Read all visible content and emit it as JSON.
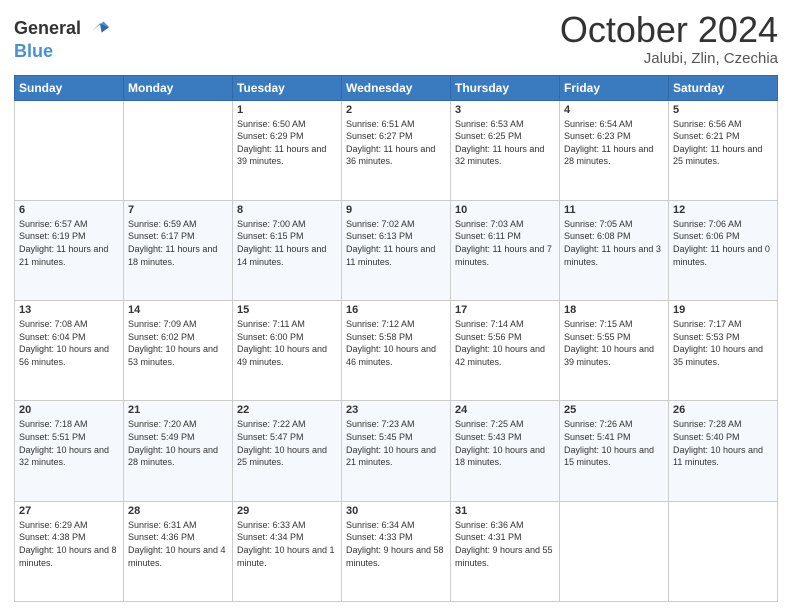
{
  "logo": {
    "line1": "General",
    "line2": "Blue"
  },
  "header": {
    "month": "October 2024",
    "location": "Jalubi, Zlin, Czechia"
  },
  "weekdays": [
    "Sunday",
    "Monday",
    "Tuesday",
    "Wednesday",
    "Thursday",
    "Friday",
    "Saturday"
  ],
  "weeks": [
    [
      {
        "day": "",
        "content": ""
      },
      {
        "day": "",
        "content": ""
      },
      {
        "day": "1",
        "content": "Sunrise: 6:50 AM\nSunset: 6:29 PM\nDaylight: 11 hours and 39 minutes."
      },
      {
        "day": "2",
        "content": "Sunrise: 6:51 AM\nSunset: 6:27 PM\nDaylight: 11 hours and 36 minutes."
      },
      {
        "day": "3",
        "content": "Sunrise: 6:53 AM\nSunset: 6:25 PM\nDaylight: 11 hours and 32 minutes."
      },
      {
        "day": "4",
        "content": "Sunrise: 6:54 AM\nSunset: 6:23 PM\nDaylight: 11 hours and 28 minutes."
      },
      {
        "day": "5",
        "content": "Sunrise: 6:56 AM\nSunset: 6:21 PM\nDaylight: 11 hours and 25 minutes."
      }
    ],
    [
      {
        "day": "6",
        "content": "Sunrise: 6:57 AM\nSunset: 6:19 PM\nDaylight: 11 hours and 21 minutes."
      },
      {
        "day": "7",
        "content": "Sunrise: 6:59 AM\nSunset: 6:17 PM\nDaylight: 11 hours and 18 minutes."
      },
      {
        "day": "8",
        "content": "Sunrise: 7:00 AM\nSunset: 6:15 PM\nDaylight: 11 hours and 14 minutes."
      },
      {
        "day": "9",
        "content": "Sunrise: 7:02 AM\nSunset: 6:13 PM\nDaylight: 11 hours and 11 minutes."
      },
      {
        "day": "10",
        "content": "Sunrise: 7:03 AM\nSunset: 6:11 PM\nDaylight: 11 hours and 7 minutes."
      },
      {
        "day": "11",
        "content": "Sunrise: 7:05 AM\nSunset: 6:08 PM\nDaylight: 11 hours and 3 minutes."
      },
      {
        "day": "12",
        "content": "Sunrise: 7:06 AM\nSunset: 6:06 PM\nDaylight: 11 hours and 0 minutes."
      }
    ],
    [
      {
        "day": "13",
        "content": "Sunrise: 7:08 AM\nSunset: 6:04 PM\nDaylight: 10 hours and 56 minutes."
      },
      {
        "day": "14",
        "content": "Sunrise: 7:09 AM\nSunset: 6:02 PM\nDaylight: 10 hours and 53 minutes."
      },
      {
        "day": "15",
        "content": "Sunrise: 7:11 AM\nSunset: 6:00 PM\nDaylight: 10 hours and 49 minutes."
      },
      {
        "day": "16",
        "content": "Sunrise: 7:12 AM\nSunset: 5:58 PM\nDaylight: 10 hours and 46 minutes."
      },
      {
        "day": "17",
        "content": "Sunrise: 7:14 AM\nSunset: 5:56 PM\nDaylight: 10 hours and 42 minutes."
      },
      {
        "day": "18",
        "content": "Sunrise: 7:15 AM\nSunset: 5:55 PM\nDaylight: 10 hours and 39 minutes."
      },
      {
        "day": "19",
        "content": "Sunrise: 7:17 AM\nSunset: 5:53 PM\nDaylight: 10 hours and 35 minutes."
      }
    ],
    [
      {
        "day": "20",
        "content": "Sunrise: 7:18 AM\nSunset: 5:51 PM\nDaylight: 10 hours and 32 minutes."
      },
      {
        "day": "21",
        "content": "Sunrise: 7:20 AM\nSunset: 5:49 PM\nDaylight: 10 hours and 28 minutes."
      },
      {
        "day": "22",
        "content": "Sunrise: 7:22 AM\nSunset: 5:47 PM\nDaylight: 10 hours and 25 minutes."
      },
      {
        "day": "23",
        "content": "Sunrise: 7:23 AM\nSunset: 5:45 PM\nDaylight: 10 hours and 21 minutes."
      },
      {
        "day": "24",
        "content": "Sunrise: 7:25 AM\nSunset: 5:43 PM\nDaylight: 10 hours and 18 minutes."
      },
      {
        "day": "25",
        "content": "Sunrise: 7:26 AM\nSunset: 5:41 PM\nDaylight: 10 hours and 15 minutes."
      },
      {
        "day": "26",
        "content": "Sunrise: 7:28 AM\nSunset: 5:40 PM\nDaylight: 10 hours and 11 minutes."
      }
    ],
    [
      {
        "day": "27",
        "content": "Sunrise: 6:29 AM\nSunset: 4:38 PM\nDaylight: 10 hours and 8 minutes."
      },
      {
        "day": "28",
        "content": "Sunrise: 6:31 AM\nSunset: 4:36 PM\nDaylight: 10 hours and 4 minutes."
      },
      {
        "day": "29",
        "content": "Sunrise: 6:33 AM\nSunset: 4:34 PM\nDaylight: 10 hours and 1 minute."
      },
      {
        "day": "30",
        "content": "Sunrise: 6:34 AM\nSunset: 4:33 PM\nDaylight: 9 hours and 58 minutes."
      },
      {
        "day": "31",
        "content": "Sunrise: 6:36 AM\nSunset: 4:31 PM\nDaylight: 9 hours and 55 minutes."
      },
      {
        "day": "",
        "content": ""
      },
      {
        "day": "",
        "content": ""
      }
    ]
  ]
}
